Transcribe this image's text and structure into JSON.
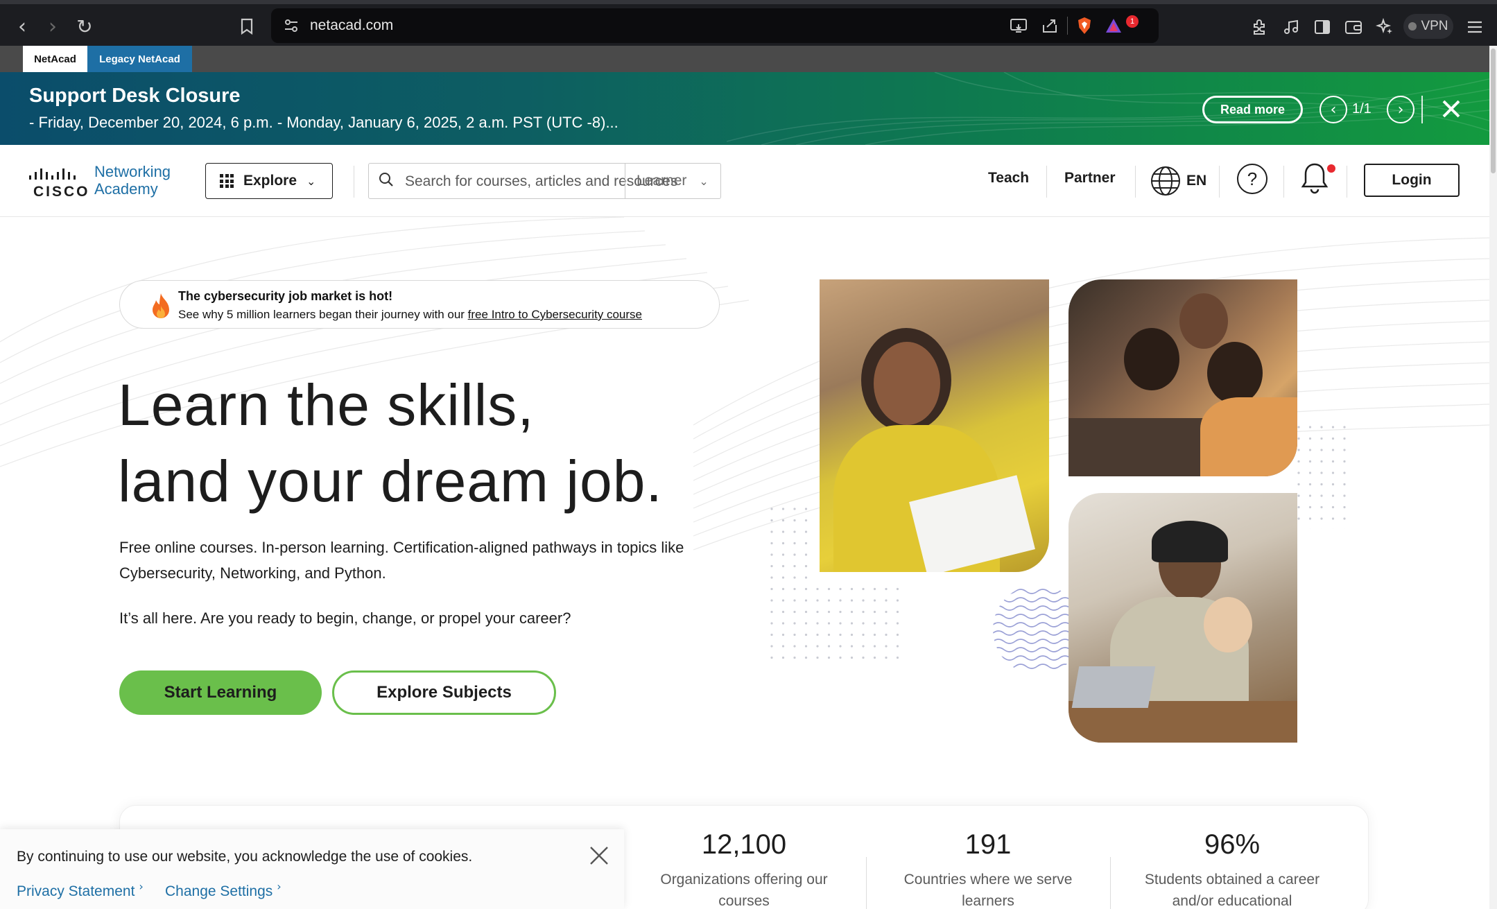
{
  "browser": {
    "url": "netacad.com",
    "vpn_label": "VPN",
    "notification_badge": "1"
  },
  "tabs": {
    "netacad": "NetAcad",
    "legacy": "Legacy NetAcad"
  },
  "banner": {
    "title": "Support Desk Closure",
    "subtitle": "- Friday, December 20, 2024, 6 p.m. - Monday, January 6, 2025, 2 a.m. PST (UTC -8)...",
    "read_more": "Read more",
    "pager": "1/1"
  },
  "header": {
    "logo_cisco": "CISCO",
    "logo_line1": "Networking",
    "logo_line2": "Academy",
    "explore": "Explore",
    "search_placeholder": "Search for courses, articles and resources",
    "search_scope": "Learner",
    "teach": "Teach",
    "partner": "Partner",
    "language": "EN",
    "login": "Login"
  },
  "hero": {
    "promo_title": "The cybersecurity job market is hot!",
    "promo_text": "See why 5 million learners began their journey with our ",
    "promo_link": "free Intro to Cybersecurity course",
    "headline_line1": "Learn the skills,",
    "headline_line2": "land your dream job.",
    "description_line1": "Free online courses. In-person learning. Certification-aligned pathways in topics like",
    "description_line2": "Cybersecurity, Networking, and Python.",
    "description_2": "It’s all here. Are you ready to begin, change, or propel your career?",
    "start_learning": "Start Learning",
    "explore_subjects": "Explore Subjects"
  },
  "stats": [
    {
      "value": "12,100",
      "label_line1": "Organizations offering our",
      "label_line2": "courses"
    },
    {
      "value": "191",
      "label_line1": "Countries where we serve",
      "label_line2": "learners"
    },
    {
      "value": "96%",
      "label_line1": "Students obtained a career",
      "label_line2": "and/or educational"
    }
  ],
  "cookie": {
    "text": "By continuing to use our website, you acknowledge the use of cookies.",
    "privacy": "Privacy Statement",
    "settings": "Change Settings"
  },
  "colors": {
    "accent_green": "#6abf4b",
    "link_blue": "#1e6fa5",
    "banner_start": "#0b4d6b",
    "banner_end": "#139a3f",
    "notification_red": "#e8292f"
  }
}
